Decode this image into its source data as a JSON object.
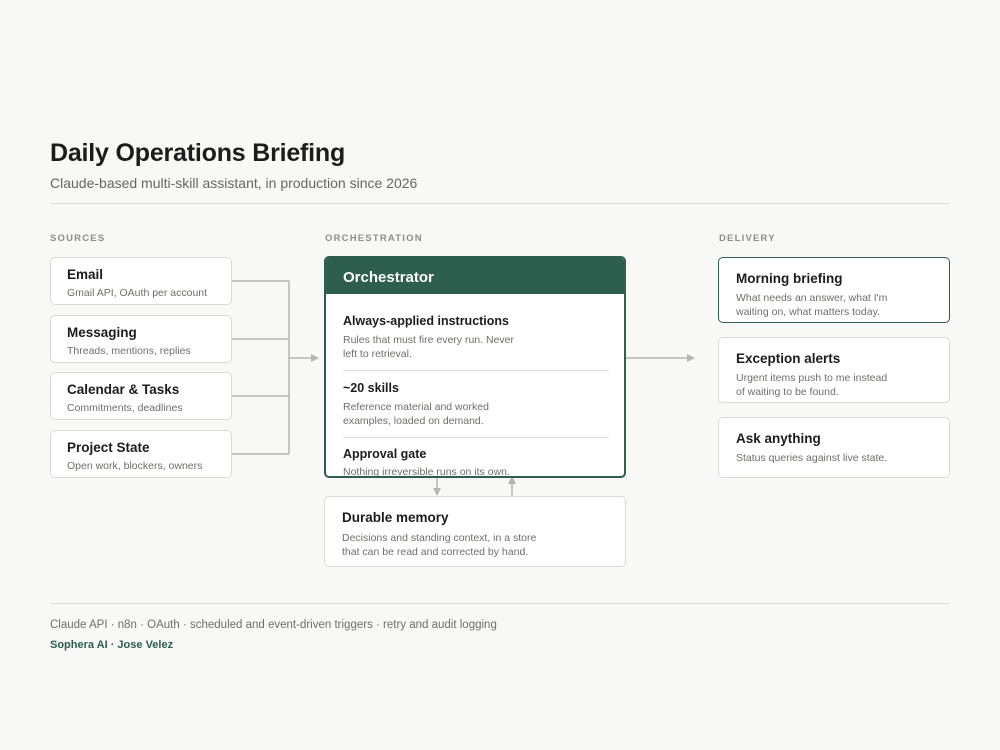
{
  "header": {
    "title": "Daily Operations Briefing",
    "subtitle": "Claude-based multi-skill assistant, in production since 2026"
  },
  "columns": {
    "sources": "SOURCES",
    "orchestration": "ORCHESTRATION",
    "delivery": "DELIVERY"
  },
  "sources": [
    {
      "name": "Email",
      "desc": "Gmail API, OAuth per account"
    },
    {
      "name": "Messaging",
      "desc": "Threads, mentions, replies"
    },
    {
      "name": "Calendar & Tasks",
      "desc": "Commitments, deadlines"
    },
    {
      "name": "Project State",
      "desc": "Open work, blockers, owners"
    }
  ],
  "orchestrator": {
    "title": "Orchestrator",
    "items": [
      {
        "name": "Always-applied instructions",
        "desc": "Rules that must fire every run. Never left to retrieval."
      },
      {
        "name": "~20 skills",
        "desc": "Reference material and worked examples, loaded on demand."
      },
      {
        "name": "Approval gate",
        "desc": "Nothing irreversible runs on its own."
      }
    ]
  },
  "memory": {
    "name": "Durable memory",
    "desc": "Decisions and standing context, in a store that can be read and corrected by hand."
  },
  "delivery": [
    {
      "name": "Morning briefing",
      "desc": "What needs an answer, what I'm waiting on, what matters today."
    },
    {
      "name": "Exception alerts",
      "desc": "Urgent items push to me instead of waiting to be found."
    },
    {
      "name": "Ask anything",
      "desc": "Status queries against live state."
    }
  ],
  "footer": {
    "tech": "Claude API · n8n · OAuth · scheduled and event-driven triggers · retry and audit logging",
    "brand": "Sophera AI · Jose Velez"
  },
  "colors": {
    "accent": "#2e5e4e",
    "connector": "#b5b5b1",
    "border": "#d9d9d5",
    "background": "#f8f8f6"
  }
}
